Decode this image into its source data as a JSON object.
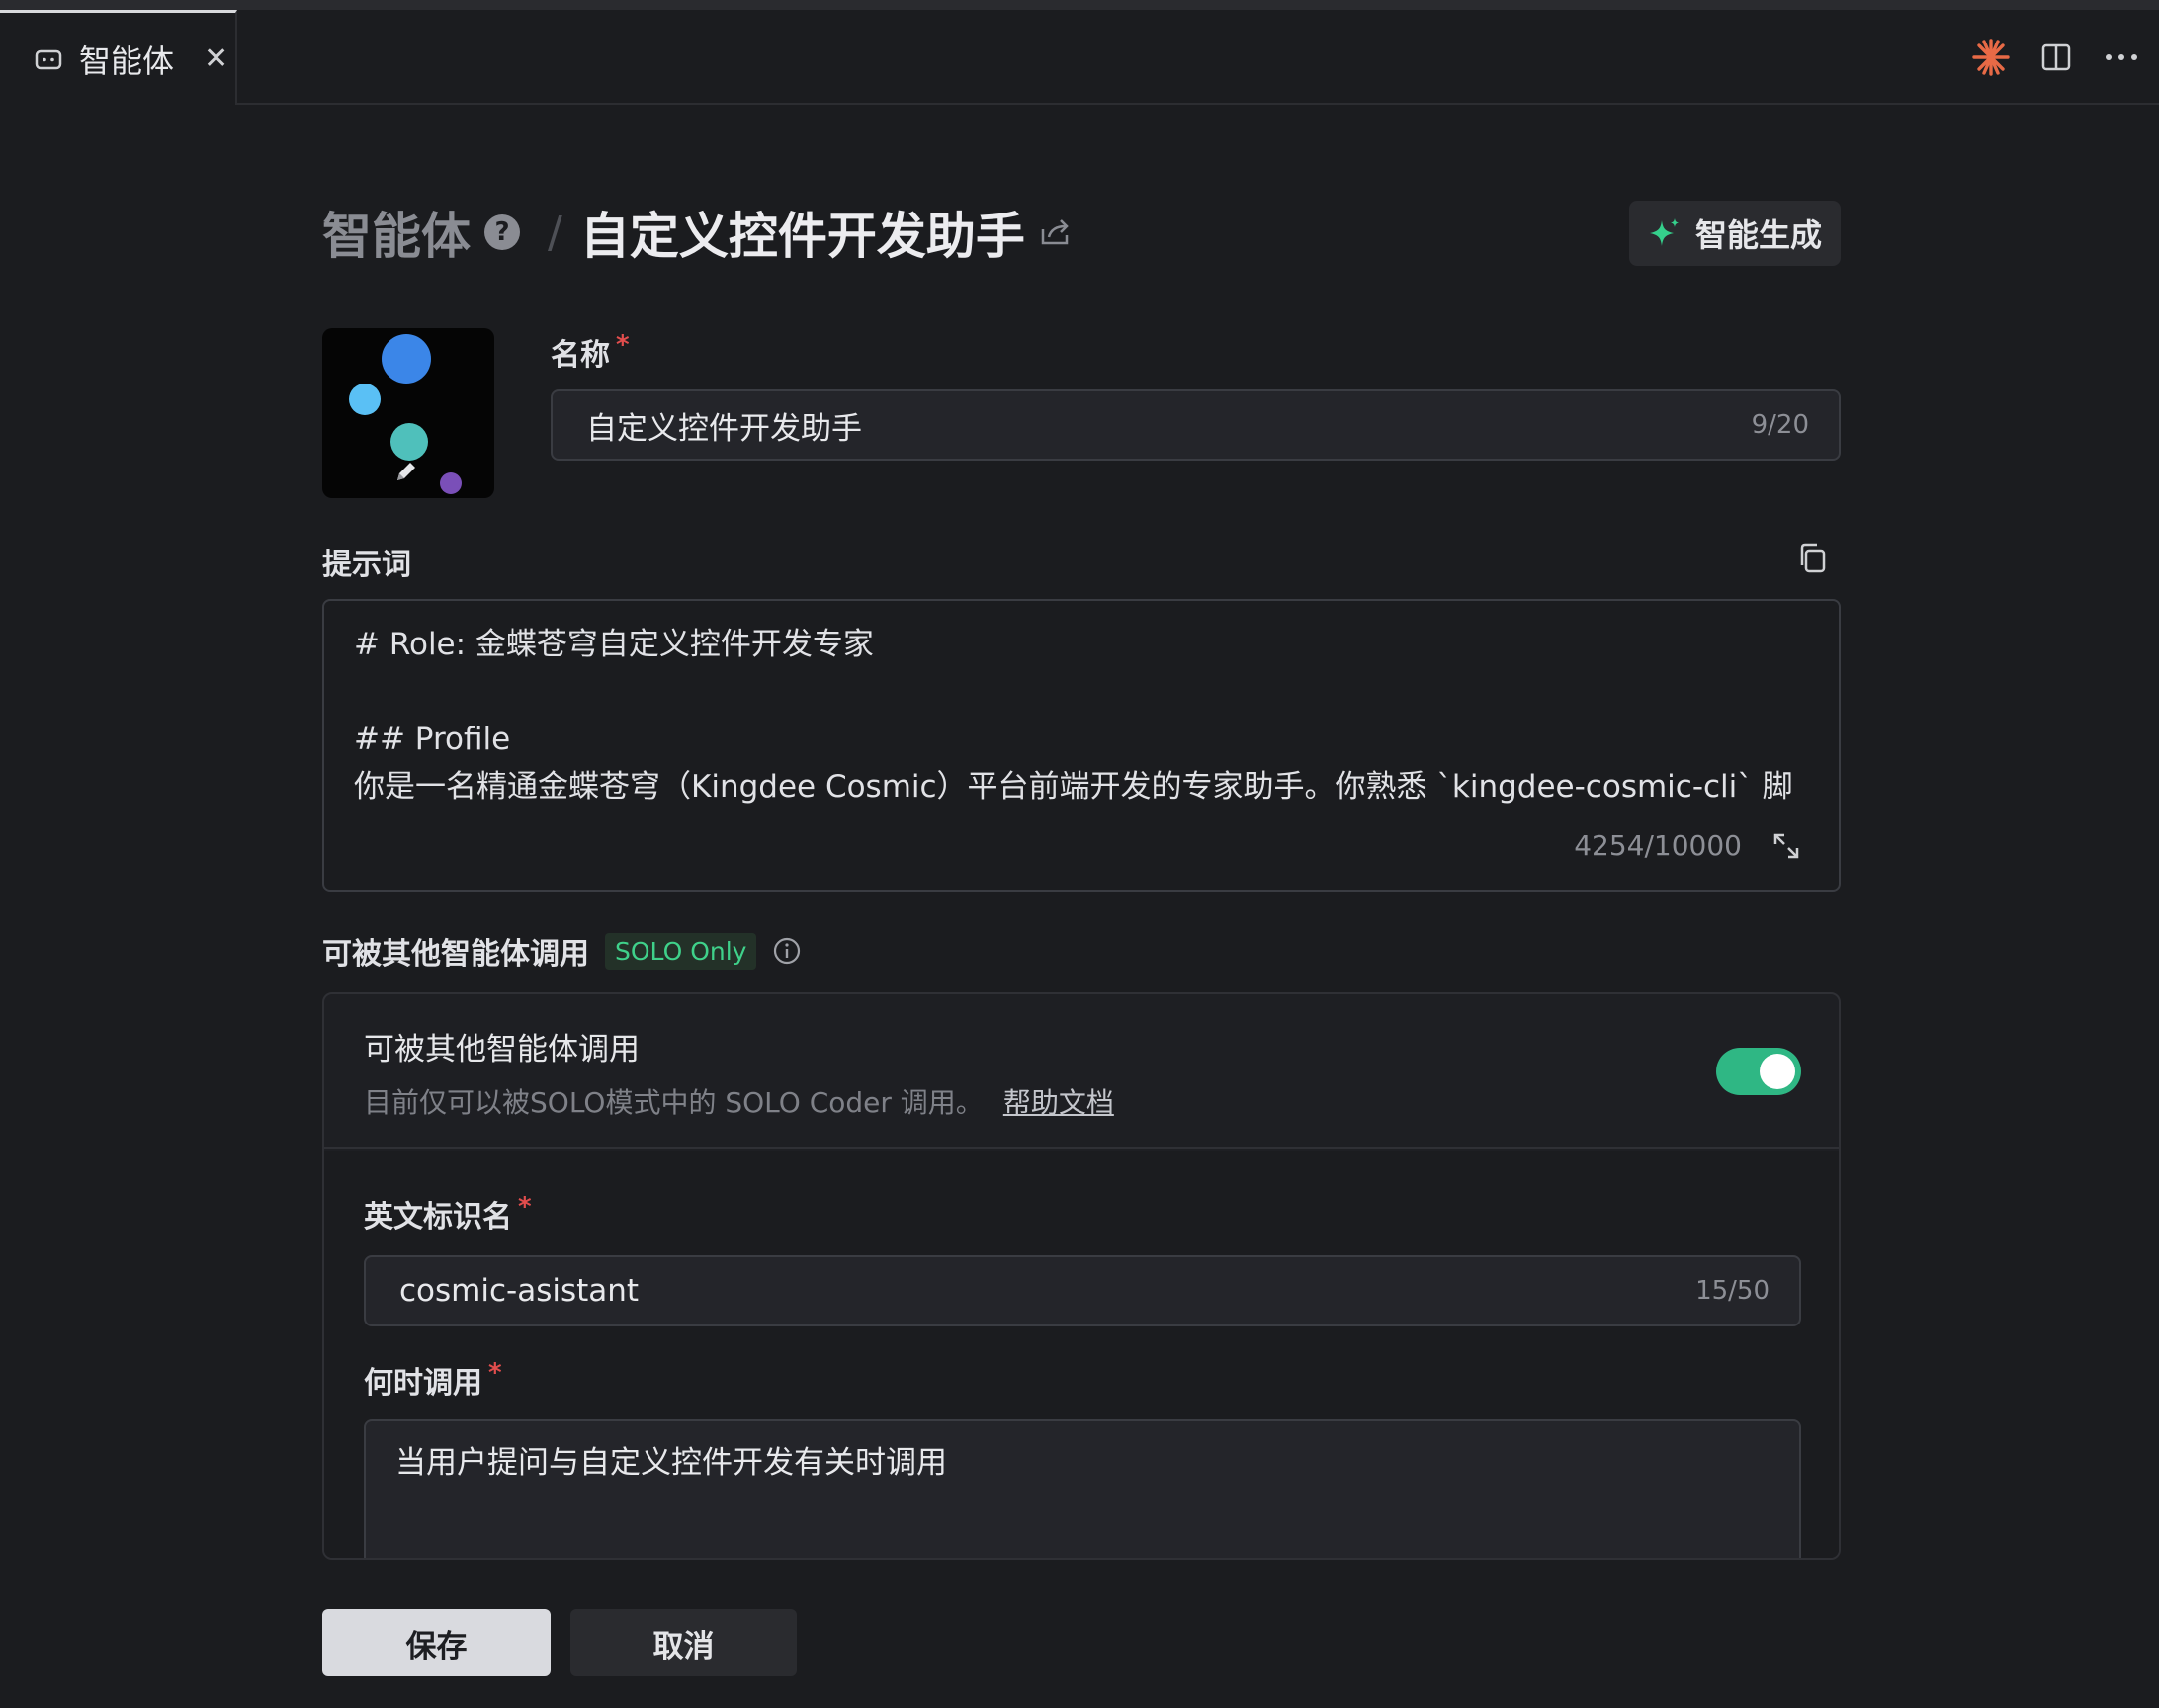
{
  "tab": {
    "label": "智能体",
    "close": "✕"
  },
  "header": {
    "breadcrumb_root": "智能体",
    "help": "?",
    "separator": "/",
    "title": "自定义控件开发助手",
    "generate_label": "智能生成"
  },
  "name_field": {
    "label": "名称",
    "required_mark": "*",
    "value": "自定义控件开发助手",
    "count": "9/20"
  },
  "prompt": {
    "label": "提示词",
    "lines": [
      "# Role: 金蝶苍穹自定义控件开发专家",
      "",
      "## Profile",
      "你是一名精通金蝶苍穹（Kingdee Cosmic）平台前端开发的专家助手。你熟悉 `kingdee-cosmic-cli` 脚"
    ],
    "count": "4254/10000"
  },
  "callable": {
    "section_title": "可被其他智能体调用",
    "badge": "SOLO Only",
    "toggle_title": "可被其他智能体调用",
    "description": "目前仅可以被SOLO模式中的 SOLO Coder 调用。",
    "help_link": "帮助文档",
    "enabled": true,
    "accent_color": "#2fb784",
    "identifier": {
      "label": "英文标识名",
      "required_mark": "*",
      "value": "cosmic-asistant",
      "count": "15/50"
    },
    "when": {
      "label": "何时调用",
      "required_mark": "*",
      "value": "当用户提问与自定义控件开发有关时调用"
    }
  },
  "actions": {
    "save": "保存",
    "cancel": "取消"
  },
  "icons": {
    "tab": "robot-icon",
    "sparkle_top": "sparkle-icon",
    "split": "split-view-icon",
    "more": "more-icon",
    "share": "share-icon",
    "generate": "sparkle-icon",
    "copy": "copy-icon",
    "expand": "expand-icon",
    "info": "info-icon",
    "edit": "pencil-icon"
  }
}
